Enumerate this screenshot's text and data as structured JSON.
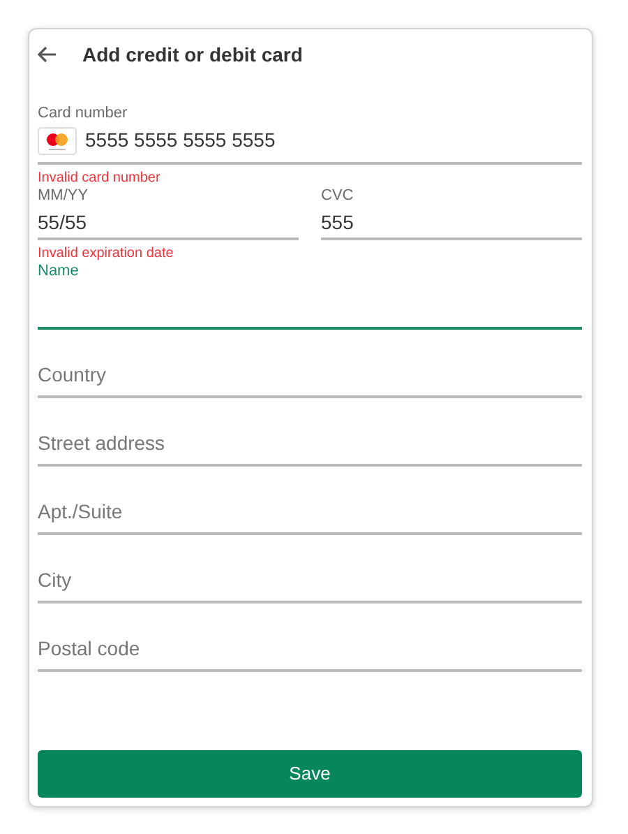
{
  "header": {
    "title": "Add credit or debit card"
  },
  "fields": [
    {
      "kind": "card",
      "label": "Card number",
      "value": "5555 5555 5555 5555",
      "error": "Invalid card number",
      "focused": false
    },
    {
      "kind": "pair",
      "items": [
        {
          "label": "MM/YY",
          "value": "55/55",
          "error": "Invalid expiration date",
          "focused": false
        },
        {
          "label": "CVC",
          "value": "555",
          "focused": false
        }
      ]
    },
    {
      "kind": "text",
      "label": "Name",
      "focused": true
    },
    {
      "kind": "text",
      "placeholder": "Country",
      "focused": false
    },
    {
      "kind": "text",
      "placeholder": "Street address",
      "focused": false
    },
    {
      "kind": "text",
      "placeholder": "Apt./Suite",
      "focused": false
    },
    {
      "kind": "text",
      "placeholder": "City",
      "focused": false
    },
    {
      "kind": "text",
      "placeholder": "Postal code",
      "focused": false
    }
  ],
  "save_button": "Save"
}
